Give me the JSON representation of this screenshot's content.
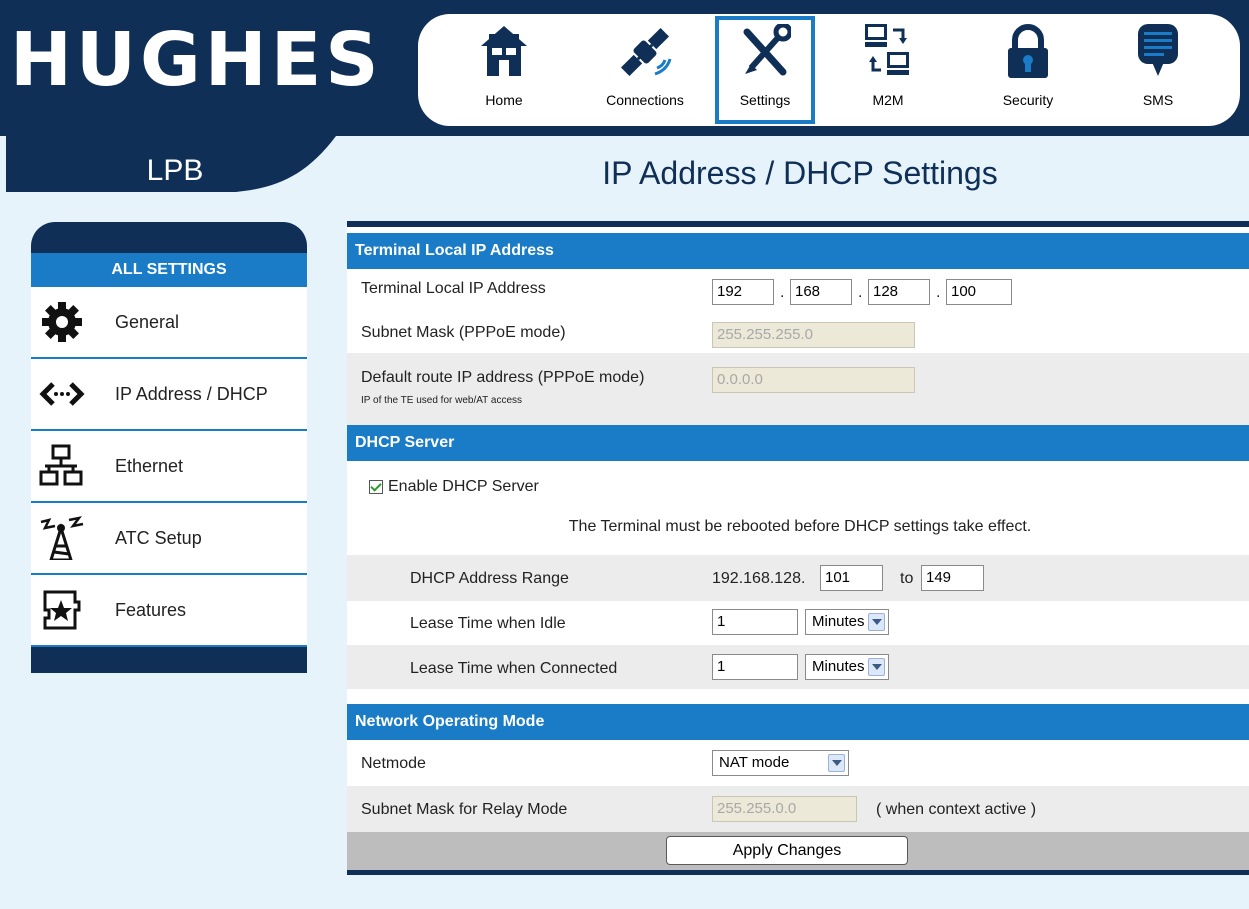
{
  "brand": "HUGHES",
  "nav": [
    {
      "label": "Home",
      "icon": "home-icon"
    },
    {
      "label": "Connections",
      "icon": "satellite-icon"
    },
    {
      "label": "Settings",
      "icon": "tools-icon"
    },
    {
      "label": "M2M",
      "icon": "m2m-computers-icon"
    },
    {
      "label": "Security",
      "icon": "padlock-icon"
    },
    {
      "label": "SMS",
      "icon": "sms-bubble-icon"
    }
  ],
  "device_tab": "LPB",
  "page_title": "IP Address / DHCP Settings",
  "sidebar": {
    "heading": "ALL SETTINGS",
    "items": [
      {
        "label": "General",
        "icon": "gear-icon"
      },
      {
        "label": "IP Address / DHCP",
        "icon": "code-arrows-icon"
      },
      {
        "label": "Ethernet",
        "icon": "network-icon"
      },
      {
        "label": "ATC Setup",
        "icon": "tower-icon"
      },
      {
        "label": "Features",
        "icon": "puzzle-star-icon"
      }
    ]
  },
  "terminal": {
    "section_title": "Terminal Local IP Address",
    "ip_label": "Terminal Local IP Address",
    "ip_octets": [
      "192",
      "168",
      "128",
      "100"
    ],
    "octet_sep": ".",
    "subnet_label": "Subnet Mask (PPPoE mode)",
    "subnet_value": "255.255.255.0",
    "route_label": "Default route IP address (PPPoE mode)",
    "route_sublabel": "IP of the TE used for web/AT access",
    "route_value": "0.0.0.0"
  },
  "dhcp": {
    "section_title": "DHCP Server",
    "enable_label": "Enable DHCP Server",
    "enabled": true,
    "notice": "The Terminal must be rebooted before DHCP settings take effect.",
    "range_label": "DHCP Address Range",
    "range_prefix": "192.168.128.",
    "range_start": "101",
    "range_to": "to",
    "range_end": "149",
    "idle_label": "Lease Time when Idle",
    "idle_value": "1",
    "idle_unit": "Minutes",
    "connected_label": "Lease Time when Connected",
    "connected_value": "1",
    "connected_unit": "Minutes"
  },
  "network": {
    "section_title": "Network Operating Mode",
    "netmode_label": "Netmode",
    "netmode_value": "NAT mode",
    "relay_label": "Subnet Mask for Relay Mode",
    "relay_value": "255.255.0.0",
    "relay_note": "( when context active )"
  },
  "apply_label": "Apply Changes",
  "colors": {
    "navy": "#0f2f56",
    "blue": "#1a7cc7",
    "background": "#e6f3fb"
  }
}
